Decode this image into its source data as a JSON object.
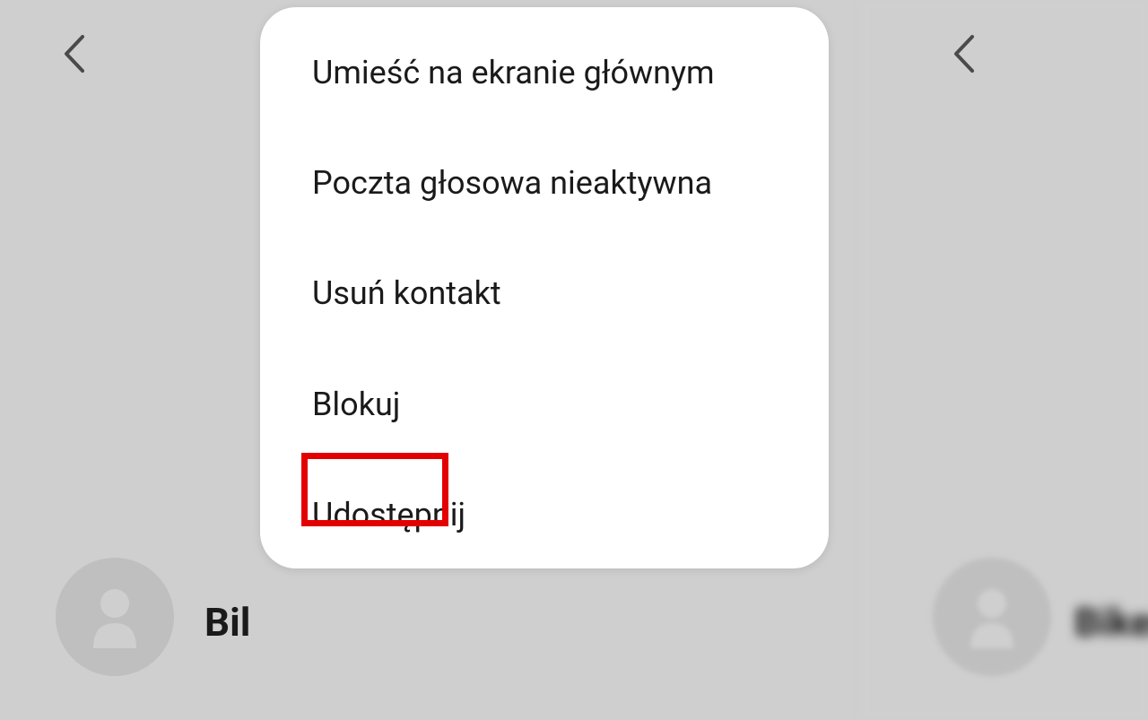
{
  "back_icon_name": "back",
  "contact": {
    "name_left_fragment": "Bil",
    "name_right_fragment": "Biker"
  },
  "menu": {
    "items": [
      {
        "label": "Umieść na ekranie głównym",
        "highlighted": false
      },
      {
        "label": "Poczta głosowa nieaktywna",
        "highlighted": false
      },
      {
        "label": "Usuń kontakt",
        "highlighted": false
      },
      {
        "label": "Blokuj",
        "highlighted": true
      },
      {
        "label": "Udostępnij",
        "highlighted": false
      }
    ]
  },
  "highlight_color": "#e30000"
}
